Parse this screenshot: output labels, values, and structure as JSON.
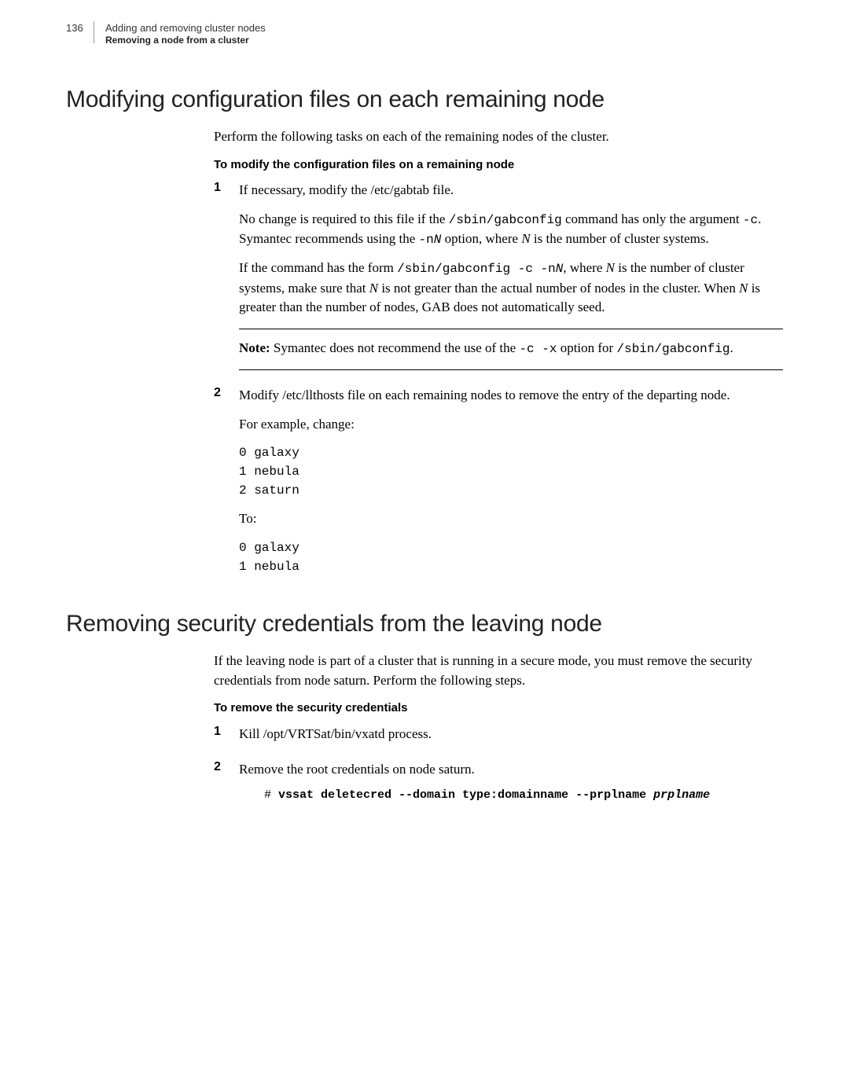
{
  "header": {
    "page_number": "136",
    "chapter": "Adding and removing cluster nodes",
    "section": "Removing a node from a cluster"
  },
  "section1": {
    "title": "Modifying configuration files on each remaining node",
    "intro": "Perform the following tasks on each of the remaining nodes of the cluster.",
    "subtitle": "To modify the configuration files on a remaining node",
    "step1": {
      "num": "1",
      "p1": "If necessary, modify the /etc/gabtab file.",
      "p2a": "No change is required to this file if the ",
      "p2_cmd1": "/sbin/gabconfig",
      "p2b": " command has only the argument ",
      "p2_cmd2": "-c",
      "p2c": ". Symantec recommends using the ",
      "p2_cmd3": "-n",
      "p2_italic1": "N",
      "p2d": " option, where ",
      "p2_italic2": "N",
      "p2e": " is the number of cluster systems.",
      "p3a": "If the command has the form ",
      "p3_cmd1": "/sbin/gabconfig -c -n",
      "p3_italic1": "N",
      "p3b": ", where ",
      "p3_italic2": "N",
      "p3c": " is the number of cluster systems, make sure that ",
      "p3_italic3": "N",
      "p3d": " is not greater than the actual number of nodes in the cluster. When ",
      "p3_italic4": "N",
      "p3e": " is greater than the number of nodes, GAB does not automatically seed.",
      "note_label": "Note:",
      "note_a": " Symantec does not recommend the use of the ",
      "note_cmd1": "-c -x",
      "note_b": " option for ",
      "note_cmd2": "/sbin/gabconfig",
      "note_c": "."
    },
    "step2": {
      "num": "2",
      "p1": "Modify /etc/llthosts file on each remaining nodes to remove the entry of the departing node.",
      "p2": "For example, change:",
      "code1": "0 galaxy\n1 nebula\n2 saturn",
      "p3": "To:",
      "code2": "0 galaxy\n1 nebula"
    }
  },
  "section2": {
    "title": "Removing security credentials from the leaving node",
    "intro": "If the leaving node is part of a cluster that is running in a secure mode, you must remove the security credentials from node saturn. Perform the following steps.",
    "subtitle": "To remove the security credentials",
    "step1": {
      "num": "1",
      "text": "Kill /opt/VRTSat/bin/vxatd process."
    },
    "step2": {
      "num": "2",
      "text": "Remove the root credentials on node saturn.",
      "cmd_prefix": "# ",
      "cmd_bold": "vssat deletecred --domain type:domainname --prplname ",
      "cmd_arg": "prplname"
    }
  }
}
